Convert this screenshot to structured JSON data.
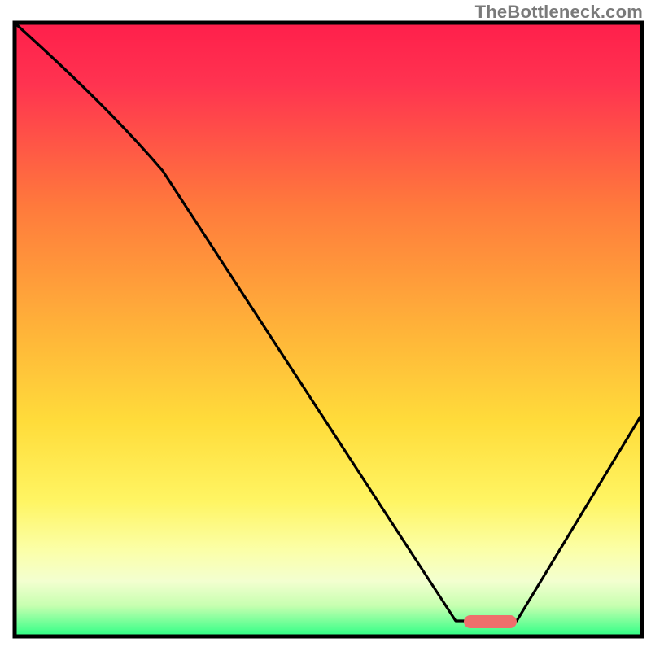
{
  "watermark": "TheBottleneck.com",
  "colors": {
    "gradient_top": "#ff1f4b",
    "gradient_mid": "#ffdc3a",
    "gradient_bottom": "#2dff85",
    "curve": "#000000",
    "marker": "#ef6f6c",
    "frame": "#000000"
  },
  "chart_data": {
    "type": "line",
    "title": "",
    "xlabel": "",
    "ylabel": "",
    "xlim": [
      0,
      100
    ],
    "ylim": [
      0,
      100
    ],
    "grid": false,
    "legend": false,
    "annotations": [
      {
        "name": "optimal-range",
        "x_start": 72,
        "x_end": 80,
        "y": 2
      }
    ],
    "series": [
      {
        "name": "bottleneck-curve",
        "x": [
          0,
          12,
          24,
          40,
          55,
          72,
          80,
          100
        ],
        "values": [
          100,
          88,
          76,
          50,
          28,
          2,
          2,
          35
        ]
      }
    ],
    "notes": "Values estimated from pixel positions; no numeric axis ticks or labels are present in the image."
  }
}
